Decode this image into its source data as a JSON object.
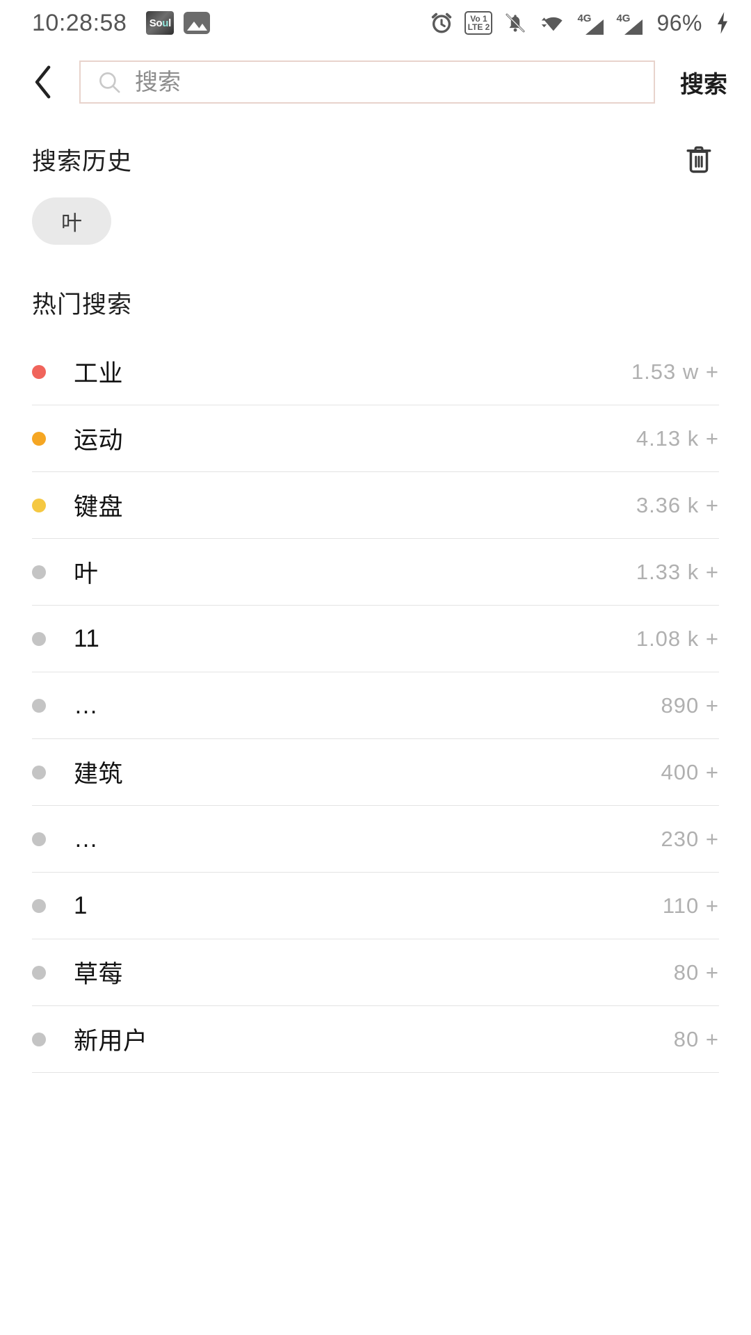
{
  "status_bar": {
    "clock": "10:28:58",
    "battery": "96%",
    "left_icons": [
      {
        "name": "soul-app-icon",
        "label": "Soul"
      },
      {
        "name": "gallery-icon",
        "label": "image"
      }
    ],
    "right_icons": [
      {
        "name": "alarm-icon"
      },
      {
        "name": "volte-icon",
        "line1": "Vo",
        "line2": "LTE",
        "slot1": "1",
        "slot2": "2"
      },
      {
        "name": "bell-muted-icon"
      },
      {
        "name": "wifi-icon"
      },
      {
        "name": "signal-4g-icon-1",
        "label": "4G"
      },
      {
        "name": "signal-4g-icon-2",
        "label": "4G"
      },
      {
        "name": "charging-bolt-icon"
      }
    ]
  },
  "header": {
    "back_icon": "chevron-left-icon",
    "search_icon": "search-icon",
    "search_placeholder": "搜索",
    "search_value": "",
    "search_action_label": "搜索",
    "border_color": "#e8d3cc"
  },
  "history": {
    "title": "搜索历史",
    "clear_icon": "trash-icon",
    "chips": [
      "叶"
    ]
  },
  "hot": {
    "title": "热门搜索",
    "items": [
      {
        "rank": 1,
        "name": "工业",
        "count": "1.53 w +",
        "dot": "#f0645b"
      },
      {
        "rank": 2,
        "name": "运动",
        "count": "4.13 k +",
        "dot": "#f5a623"
      },
      {
        "rank": 3,
        "name": "键盘",
        "count": "3.36 k +",
        "dot": "#f5c842"
      },
      {
        "rank": 4,
        "name": "叶",
        "count": "1.33 k +",
        "dot": "#c4c4c4"
      },
      {
        "rank": 5,
        "name": "11",
        "count": "1.08 k +",
        "dot": "#c4c4c4"
      },
      {
        "rank": 6,
        "name": "…",
        "count": "890 +",
        "dot": "#c4c4c4"
      },
      {
        "rank": 7,
        "name": "建筑",
        "count": "400 +",
        "dot": "#c4c4c4"
      },
      {
        "rank": 8,
        "name": "…",
        "count": "230 +",
        "dot": "#c4c4c4"
      },
      {
        "rank": 9,
        "name": "1",
        "count": "110 +",
        "dot": "#c4c4c4"
      },
      {
        "rank": 10,
        "name": "草莓",
        "count": "80 +",
        "dot": "#c4c4c4"
      },
      {
        "rank": 11,
        "name": "新用户",
        "count": "80 +",
        "dot": "#c4c4c4"
      }
    ]
  }
}
